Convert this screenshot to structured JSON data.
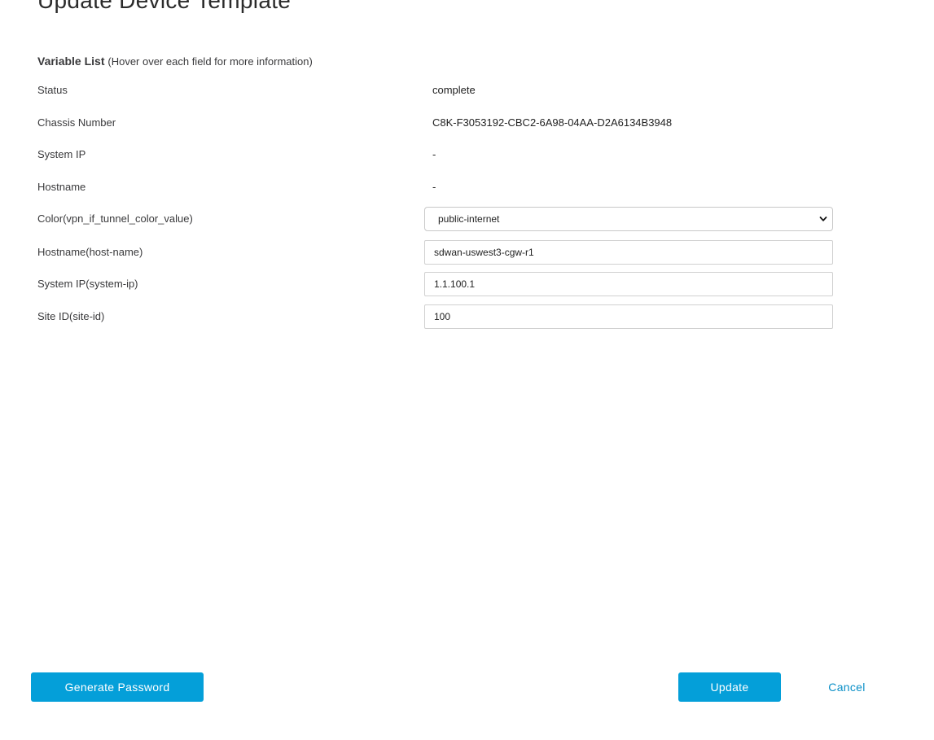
{
  "page": {
    "title": "Update Device Template"
  },
  "variable_list": {
    "heading": "Variable List",
    "hint": "(Hover over each field for more information)"
  },
  "info_rows": {
    "status": {
      "label": "Status",
      "value": "complete"
    },
    "chassis_number": {
      "label": "Chassis Number",
      "value": "C8K-F3053192-CBC2-6A98-04AA-D2A6134B3948"
    },
    "system_ip": {
      "label": "System IP",
      "value": "-"
    },
    "hostname": {
      "label": "Hostname",
      "value": "-"
    }
  },
  "fields": {
    "color": {
      "label": "Color(vpn_if_tunnel_color_value)",
      "selected": "public-internet",
      "chevron_icon": "chevron-down-icon"
    },
    "host_name": {
      "label": "Hostname(host-name)",
      "value": "sdwan-uswest3-cgw-r1"
    },
    "system_ip": {
      "label": "System IP(system-ip)",
      "value": "1.1.100.1"
    },
    "site_id": {
      "label": "Site ID(site-id)",
      "value": "100"
    }
  },
  "actions": {
    "generate_password": "Generate Password",
    "update": "Update",
    "cancel": "Cancel"
  },
  "colors": {
    "primary": "#049fd9",
    "link": "#0a8fc7",
    "text": "#39393b",
    "border": "#d0d0d0"
  }
}
